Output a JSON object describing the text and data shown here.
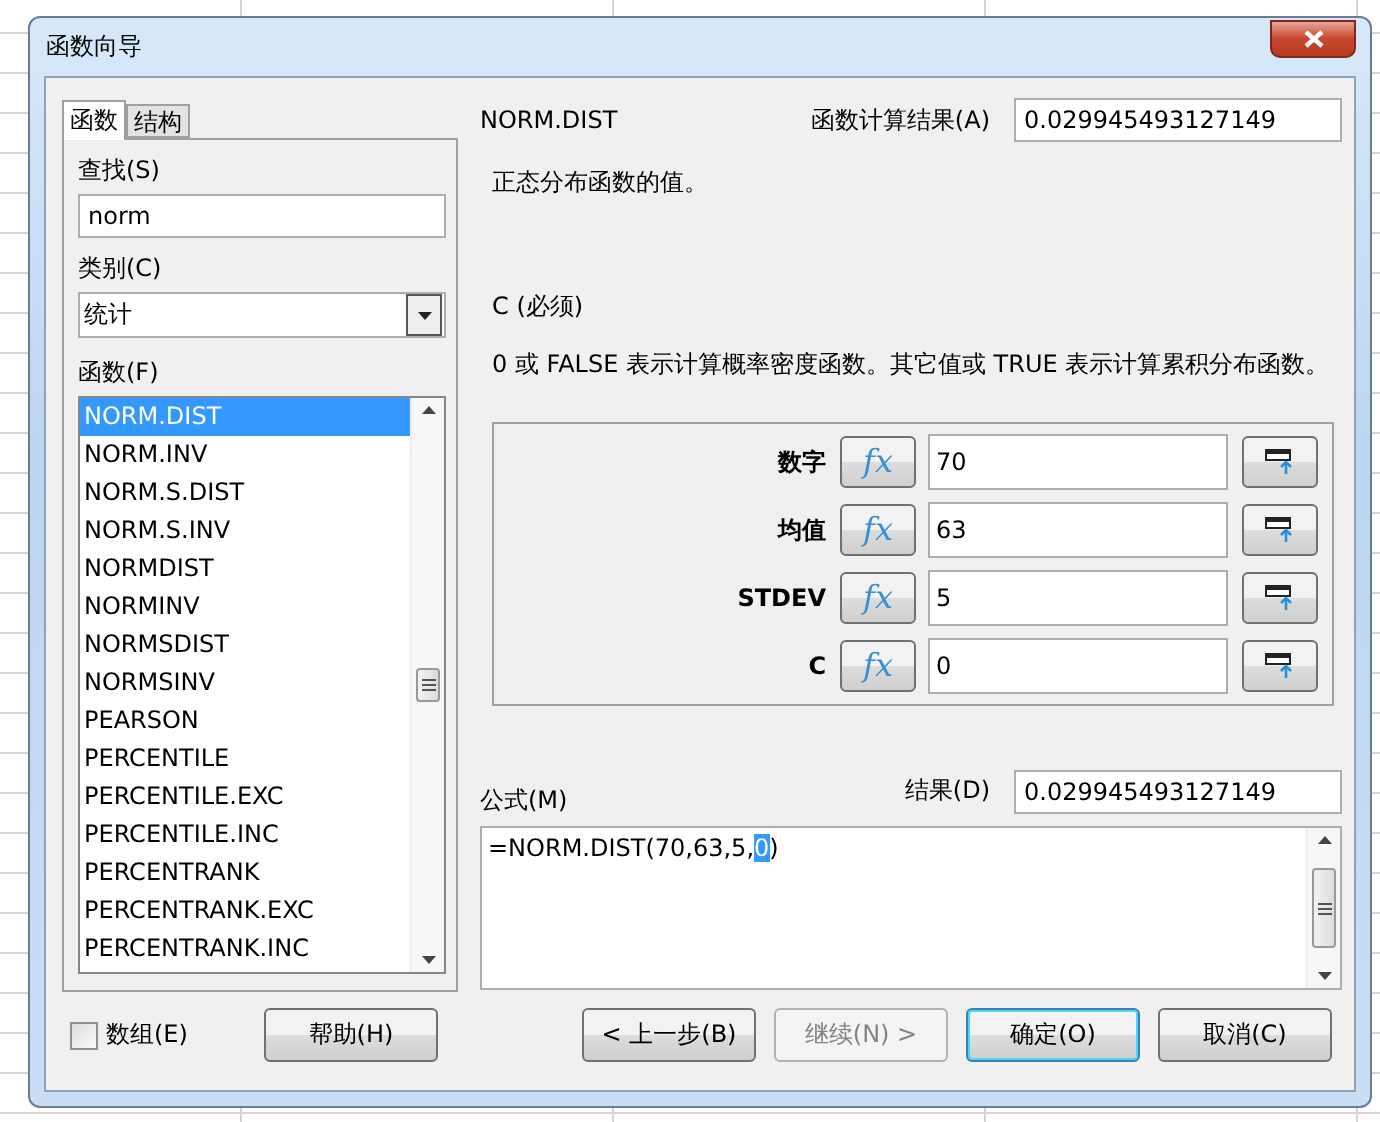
{
  "window": {
    "title": "函数向导"
  },
  "tabs": [
    {
      "label": "函数",
      "selected": true
    },
    {
      "label": "结构",
      "selected": false
    }
  ],
  "search": {
    "label": "查找(S)",
    "value": "norm"
  },
  "category": {
    "label": "类别(C)",
    "value": "统计"
  },
  "functions": {
    "label": "函数(F)",
    "items": [
      {
        "label": "NORM.DIST",
        "selected": true
      },
      {
        "label": "NORM.INV",
        "selected": false
      },
      {
        "label": "NORM.S.DIST",
        "selected": false
      },
      {
        "label": "NORM.S.INV",
        "selected": false
      },
      {
        "label": "NORMDIST",
        "selected": false
      },
      {
        "label": "NORMINV",
        "selected": false
      },
      {
        "label": "NORMSDIST",
        "selected": false
      },
      {
        "label": "NORMSINV",
        "selected": false
      },
      {
        "label": "PEARSON",
        "selected": false
      },
      {
        "label": "PERCENTILE",
        "selected": false
      },
      {
        "label": "PERCENTILE.EXC",
        "selected": false
      },
      {
        "label": "PERCENTILE.INC",
        "selected": false
      },
      {
        "label": "PERCENTRANK",
        "selected": false
      },
      {
        "label": "PERCENTRANK.EXC",
        "selected": false
      },
      {
        "label": "PERCENTRANK.INC",
        "selected": false
      }
    ]
  },
  "function_name": "NORM.DIST",
  "function_result": {
    "label": "函数计算结果(A)",
    "value": "0.029945493127149"
  },
  "description": "正态分布函数的值。",
  "argument_title": "C (必须)",
  "argument_description": "0 或 FALSE 表示计算概率密度函数。其它值或 TRUE 表示计算累积分布函数。",
  "arguments": [
    {
      "label": "数字",
      "button": "fx",
      "value": "70"
    },
    {
      "label": "均值",
      "button": "fx",
      "value": "63"
    },
    {
      "label": "STDEV",
      "button": "fx",
      "value": "5"
    },
    {
      "label": "C",
      "button": "fx",
      "value": "0"
    }
  ],
  "formula": {
    "label": "公式(M)",
    "before": "=NORM.DIST(70,63,5,",
    "selected": "0",
    "after": ")"
  },
  "result": {
    "label": "结果(D)",
    "value": "0.029945493127149"
  },
  "array_checkbox": {
    "label": "数组(E)",
    "checked": false
  },
  "help_button": "帮助(H)",
  "buttons": [
    {
      "label": "< 上一步(B)",
      "kind": "normal"
    },
    {
      "label": "继续(N) >",
      "kind": "disabled"
    },
    {
      "label": "确定(O)",
      "kind": "default"
    },
    {
      "label": "取消(C)",
      "kind": "normal"
    }
  ]
}
